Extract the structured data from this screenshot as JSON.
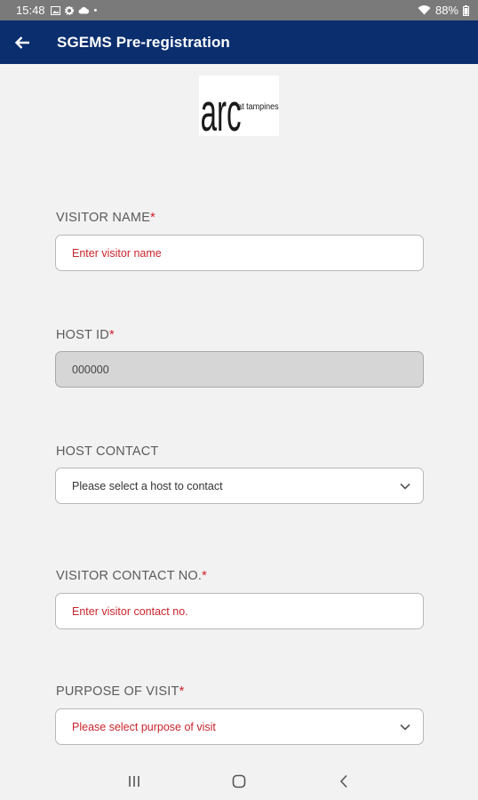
{
  "status_bar": {
    "time": "15:48",
    "battery": "88%"
  },
  "app_bar": {
    "title": "SGEMS Pre-registration"
  },
  "logo": {
    "text_main": "arc",
    "text_side": "at tampines"
  },
  "form": {
    "visitor_name": {
      "label": "VISITOR NAME",
      "required": "*",
      "placeholder": "Enter visitor name"
    },
    "host_id": {
      "label": "HOST ID",
      "required": "*",
      "value": "000000"
    },
    "host_contact": {
      "label": "HOST CONTACT",
      "placeholder": "Please select a host to contact"
    },
    "visitor_contact": {
      "label": "VISITOR CONTACT NO.",
      "required": "*",
      "placeholder": "Enter visitor contact no."
    },
    "purpose": {
      "label": "PURPOSE OF VISIT",
      "required": "*",
      "placeholder": "Please select purpose of visit"
    }
  },
  "colors": {
    "app_bar": "#0a2e6e",
    "required": "#d0202a",
    "background": "#f2f2f2"
  }
}
